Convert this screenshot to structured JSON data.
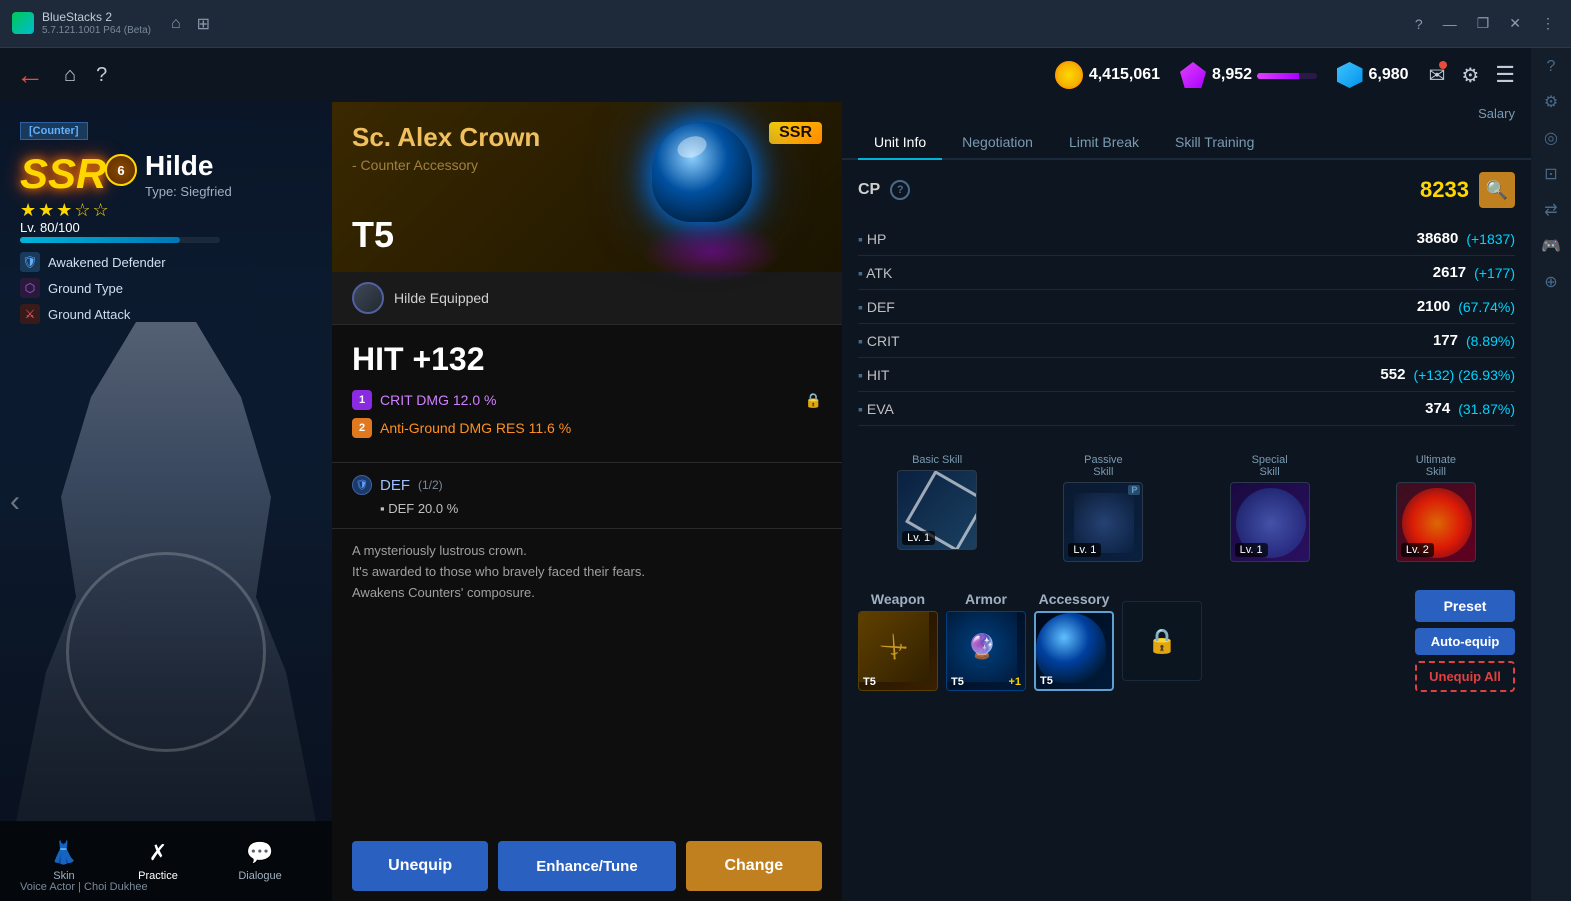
{
  "app": {
    "name": "BlueStacks 2",
    "version": "5.7.121.1001 P64 (Beta)"
  },
  "window_controls": {
    "help": "?",
    "minimize": "—",
    "restore": "❐",
    "close": "✕",
    "more": "⋮"
  },
  "nav": {
    "back_icon": "←",
    "home_icon": "⌂",
    "help_icon": "?",
    "currency": [
      {
        "name": "coins",
        "value": "4,415,061"
      },
      {
        "name": "gems",
        "value": "8,952"
      },
      {
        "name": "crystals",
        "value": "6,980"
      }
    ],
    "mail_icon": "✉",
    "settings_icon": "⚙",
    "menu_icon": "☰"
  },
  "character": {
    "tag": "[Counter]",
    "rarity": "SSR",
    "level_badge": "6",
    "name": "Hilde",
    "type": "Type: Siegfried",
    "stars": "★★★☆☆",
    "level_current": "80",
    "level_max": "100",
    "level_label": "Lv. 80/100",
    "traits": [
      {
        "label": "Awakened Defender",
        "icon": "🛡"
      },
      {
        "label": "Ground Type",
        "icon": "🔶"
      },
      {
        "label": "Ground Attack",
        "icon": "⚔"
      }
    ],
    "bottom_nav": [
      {
        "label": "Skin",
        "icon": "👗"
      },
      {
        "label": "Practice",
        "icon": "✗"
      },
      {
        "label": "Dialogue",
        "icon": "💬"
      }
    ],
    "voice_label": "Voice Actor | Choi Dukhee"
  },
  "equipment": {
    "name": "Sc. Alex Crown",
    "rarity": "SSR",
    "type": "- Counter Accessory",
    "tier": "T5",
    "equipped_by": "Hilde Equipped",
    "main_stat": "HIT +132",
    "bonuses": [
      {
        "num": "1",
        "label": "CRIT DMG 12.0 %",
        "locked": true
      },
      {
        "num": "2",
        "label": "Anti-Ground DMG RES 11.6 %"
      }
    ],
    "passive_label": "DEF (1/2)",
    "passive_fraction": "(1/2)",
    "passive_stat": "▪ DEF 20.0 %",
    "description": "A mysteriously lustrous crown.\nIt's awarded to those who bravely faced their fears.\nAwakens Counters' composure."
  },
  "unit_info": {
    "tabs": [
      {
        "label": "Unit Info",
        "active": true
      },
      {
        "label": "Salary\nNegotiation",
        "active": false
      },
      {
        "label": "Limit Break",
        "active": false
      },
      {
        "label": "Skill Training",
        "active": false
      }
    ],
    "cp_label": "CP",
    "cp_value": "8233",
    "stats": [
      {
        "label": "HP",
        "value": "38680",
        "bonus": "(+1837)"
      },
      {
        "label": "ATK",
        "value": "2617",
        "bonus": "(+177)"
      },
      {
        "label": "DEF",
        "value": "2100",
        "bonus": "(67.74%)"
      },
      {
        "label": "CRIT",
        "value": "177",
        "bonus": "(8.89%)"
      },
      {
        "label": "HIT",
        "value": "552",
        "bonus": "(+132)  (26.93%)"
      },
      {
        "label": "EVA",
        "value": "374",
        "bonus": "(31.87%)"
      }
    ],
    "skills": [
      {
        "label": "Basic Skill",
        "type": "basic",
        "level": "Lv. 1",
        "p": false
      },
      {
        "label": "Passive\nSkill",
        "type": "passive",
        "level": "Lv. 1",
        "p": true
      },
      {
        "label": "Special\nSkill",
        "type": "special",
        "level": "Lv. 1",
        "p": false
      },
      {
        "label": "Ultimate\nSkill",
        "type": "ultimate",
        "level": "Lv. 2",
        "p": false
      }
    ],
    "equip_slots": [
      {
        "label": "Weapon",
        "tier": "T5",
        "plus": ""
      },
      {
        "label": "Armor",
        "tier": "T5",
        "plus": "+1"
      },
      {
        "label": "Accessory",
        "tier": "T5",
        "plus": "",
        "active": true
      }
    ],
    "buttons": {
      "preset": "Preset",
      "auto_equip": "Auto-equip",
      "unequip_all": "Unequip All"
    }
  },
  "actions": {
    "unequip": "Unequip",
    "enhance_tune": "Enhance/Tune",
    "change": "Change"
  }
}
